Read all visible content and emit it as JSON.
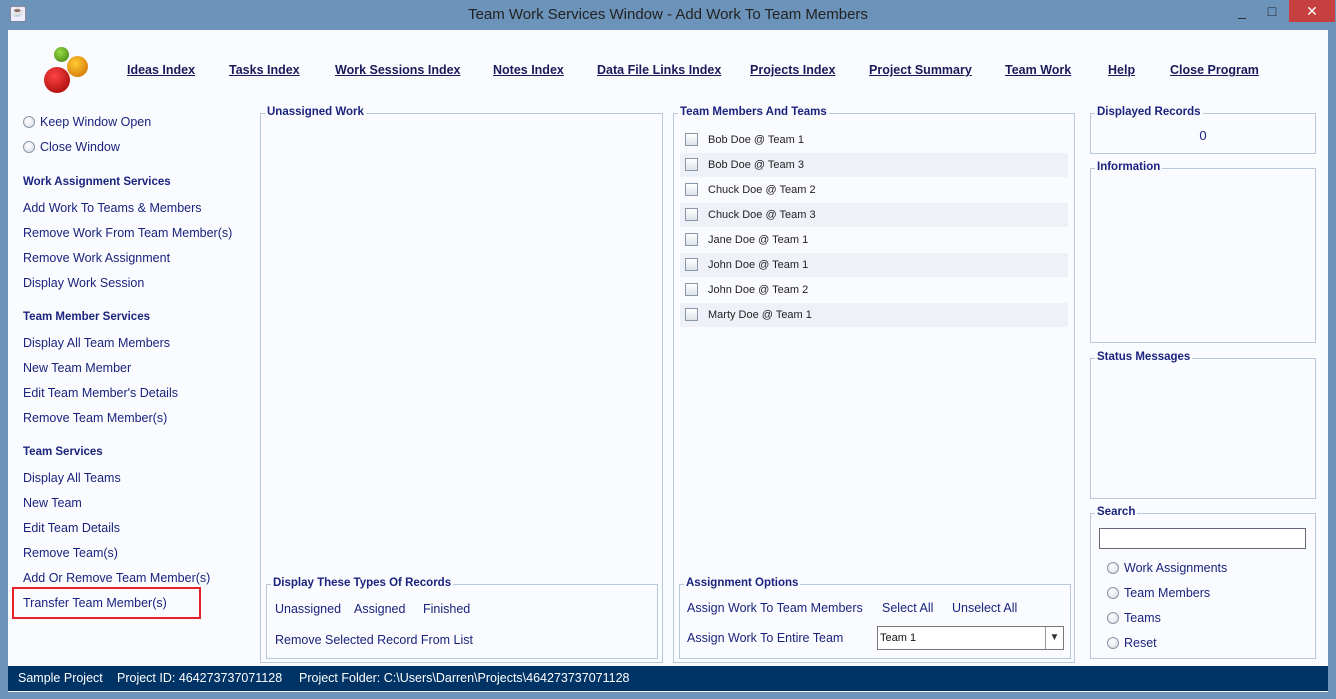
{
  "window": {
    "title": "Team Work Services Window - Add Work To Team Members",
    "minimize": "_",
    "maximize": "□",
    "close": "✕"
  },
  "nav": [
    "Ideas Index",
    "Tasks Index",
    "Work Sessions Index",
    "Notes Index",
    "Data File Links Index",
    "Projects Index",
    "Project Summary",
    "Team Work",
    "Help",
    "Close Program"
  ],
  "sidebar": {
    "keep_open": "Keep Window Open",
    "close_window": "Close Window",
    "sections": [
      {
        "title": "Work Assignment Services",
        "items": [
          "Add Work To Teams & Members",
          "Remove Work From Team Member(s)",
          "Remove Work Assignment",
          "Display Work Session"
        ]
      },
      {
        "title": "Team Member Services",
        "items": [
          "Display All Team Members",
          "New Team Member",
          "Edit Team Member's Details",
          "Remove Team Member(s)"
        ]
      },
      {
        "title": "Team Services",
        "items": [
          "Display All Teams",
          "New Team",
          "Edit Team Details",
          "Remove Team(s)",
          "Add Or Remove Team Member(s)",
          "Transfer Team Member(s)"
        ]
      }
    ],
    "highlight_color": "#e8202a"
  },
  "unassigned": {
    "title": "Unassigned Work"
  },
  "display_types": {
    "title": "Display These Types Of Records",
    "unassigned": "Unassigned",
    "assigned": "Assigned",
    "finished": "Finished",
    "remove": "Remove Selected Record From List"
  },
  "members": {
    "title": "Team Members And Teams",
    "items": [
      "Bob Doe @ Team 1",
      "Bob Doe @ Team 3",
      "Chuck Doe @ Team 2",
      "Chuck Doe @ Team 3",
      "Jane Doe @ Team 1",
      "John Doe @ Team 1",
      "John Doe @ Team 2",
      "Marty Doe @ Team 1"
    ]
  },
  "assignment": {
    "title": "Assignment Options",
    "assign_members": "Assign Work To Team Members",
    "select_all": "Select All",
    "unselect_all": "Unselect All",
    "assign_team": "Assign Work To Entire Team",
    "team_value": "Team 1"
  },
  "displayed": {
    "title": "Displayed Records",
    "count": "0"
  },
  "information": {
    "title": "Information"
  },
  "status_messages": {
    "title": "Status Messages"
  },
  "search": {
    "title": "Search",
    "value": "",
    "options": [
      "Work Assignments",
      "Team Members",
      "Teams",
      "Reset"
    ]
  },
  "statusbar": {
    "project": "Sample Project",
    "project_id": "Project ID:  464273737071128",
    "folder": "Project Folder:  C:\\Users\\Darren\\Projects\\464273737071128"
  }
}
